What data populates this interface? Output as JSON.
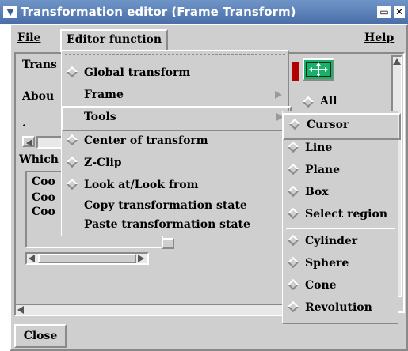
{
  "window": {
    "title": "Transformation editor (Frame Transform)"
  },
  "menubar": {
    "file": "File",
    "editor_function": "Editor function",
    "help": "Help"
  },
  "background": {
    "trans_label": "Trans",
    "about_label": "Abou",
    "dot": ".",
    "which_label": "Which",
    "list_items": [
      "Coo",
      "Coo",
      "Coo"
    ],
    "all_option": "All"
  },
  "editor_menu": {
    "items": [
      {
        "label": "Global transform",
        "indicator": true,
        "submenu": false
      },
      {
        "label": "Frame",
        "indicator": false,
        "submenu": true
      },
      {
        "label": "Tools",
        "indicator": false,
        "submenu": true
      },
      {
        "label": "Center of transform",
        "indicator": true,
        "submenu": false
      },
      {
        "label": "Z-Clip",
        "indicator": true,
        "submenu": false
      },
      {
        "label": "Look at/Look from",
        "indicator": true,
        "submenu": false
      },
      {
        "label": "Copy transformation state",
        "indicator": false,
        "submenu": false
      },
      {
        "label": "Paste transformation state",
        "indicator": false,
        "submenu": false
      }
    ]
  },
  "tools_menu": {
    "items": [
      "Cursor",
      "Line",
      "Plane",
      "Box",
      "Select region",
      "Cylinder",
      "Sphere",
      "Cone",
      "Revolution"
    ]
  },
  "footer": {
    "close": "Close"
  },
  "colors": {
    "titlebar": "#5a80b8",
    "accent_button": "#1ab06a",
    "panel": "#cfcfcf"
  },
  "icons": {
    "cursor_tool": "move-arrows-icon"
  }
}
